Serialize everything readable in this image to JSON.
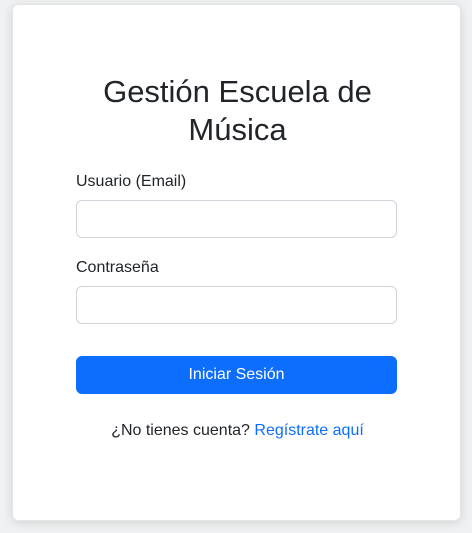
{
  "login": {
    "title_line1": "Gestión Escuela de",
    "title_line2": "Música",
    "email_label": "Usuario (Email)",
    "email_value": "",
    "password_label": "Contraseña",
    "password_value": "",
    "submit_label": "Iniciar Sesión",
    "register_prompt": "¿No tienes cuenta?",
    "register_link": "Regístrate aquí"
  },
  "colors": {
    "primary": "#0d6efd",
    "text": "#212529",
    "border": "#ced4da",
    "background": "#ffffff"
  }
}
